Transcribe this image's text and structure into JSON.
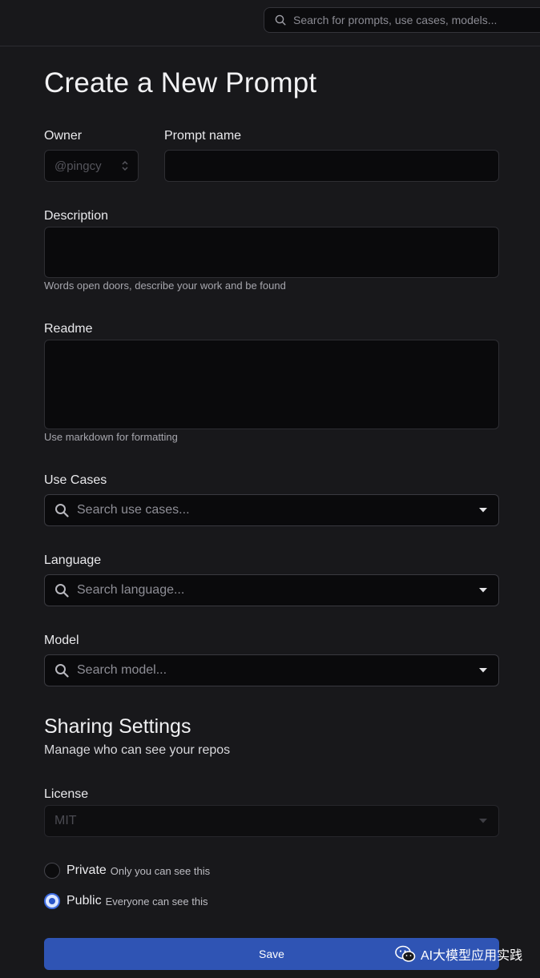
{
  "top_search": {
    "placeholder": "Search for prompts, use cases, models..."
  },
  "page_title": "Create a New Prompt",
  "owner": {
    "label": "Owner",
    "value": "@pingcy"
  },
  "prompt_name": {
    "label": "Prompt name",
    "value": ""
  },
  "description": {
    "label": "Description",
    "value": "",
    "hint": "Words open doors, describe your work and be found"
  },
  "readme": {
    "label": "Readme",
    "value": "",
    "hint": "Use markdown for formatting"
  },
  "use_cases": {
    "label": "Use Cases",
    "placeholder": "Search use cases..."
  },
  "language": {
    "label": "Language",
    "placeholder": "Search language..."
  },
  "model": {
    "label": "Model",
    "placeholder": "Search model..."
  },
  "sharing": {
    "title": "Sharing Settings",
    "subtitle": "Manage who can see your repos"
  },
  "license": {
    "label": "License",
    "value": "MIT"
  },
  "visibility": {
    "private": {
      "label": "Private",
      "desc": "Only you can see this",
      "selected": false
    },
    "public": {
      "label": "Public",
      "desc": "Everyone can see this",
      "selected": true
    }
  },
  "save_label": "Save",
  "watermark": "AI大模型应用实践",
  "colors": {
    "accent": "#2f54b4",
    "background": "#18181b",
    "field": "#0a0a0c"
  }
}
